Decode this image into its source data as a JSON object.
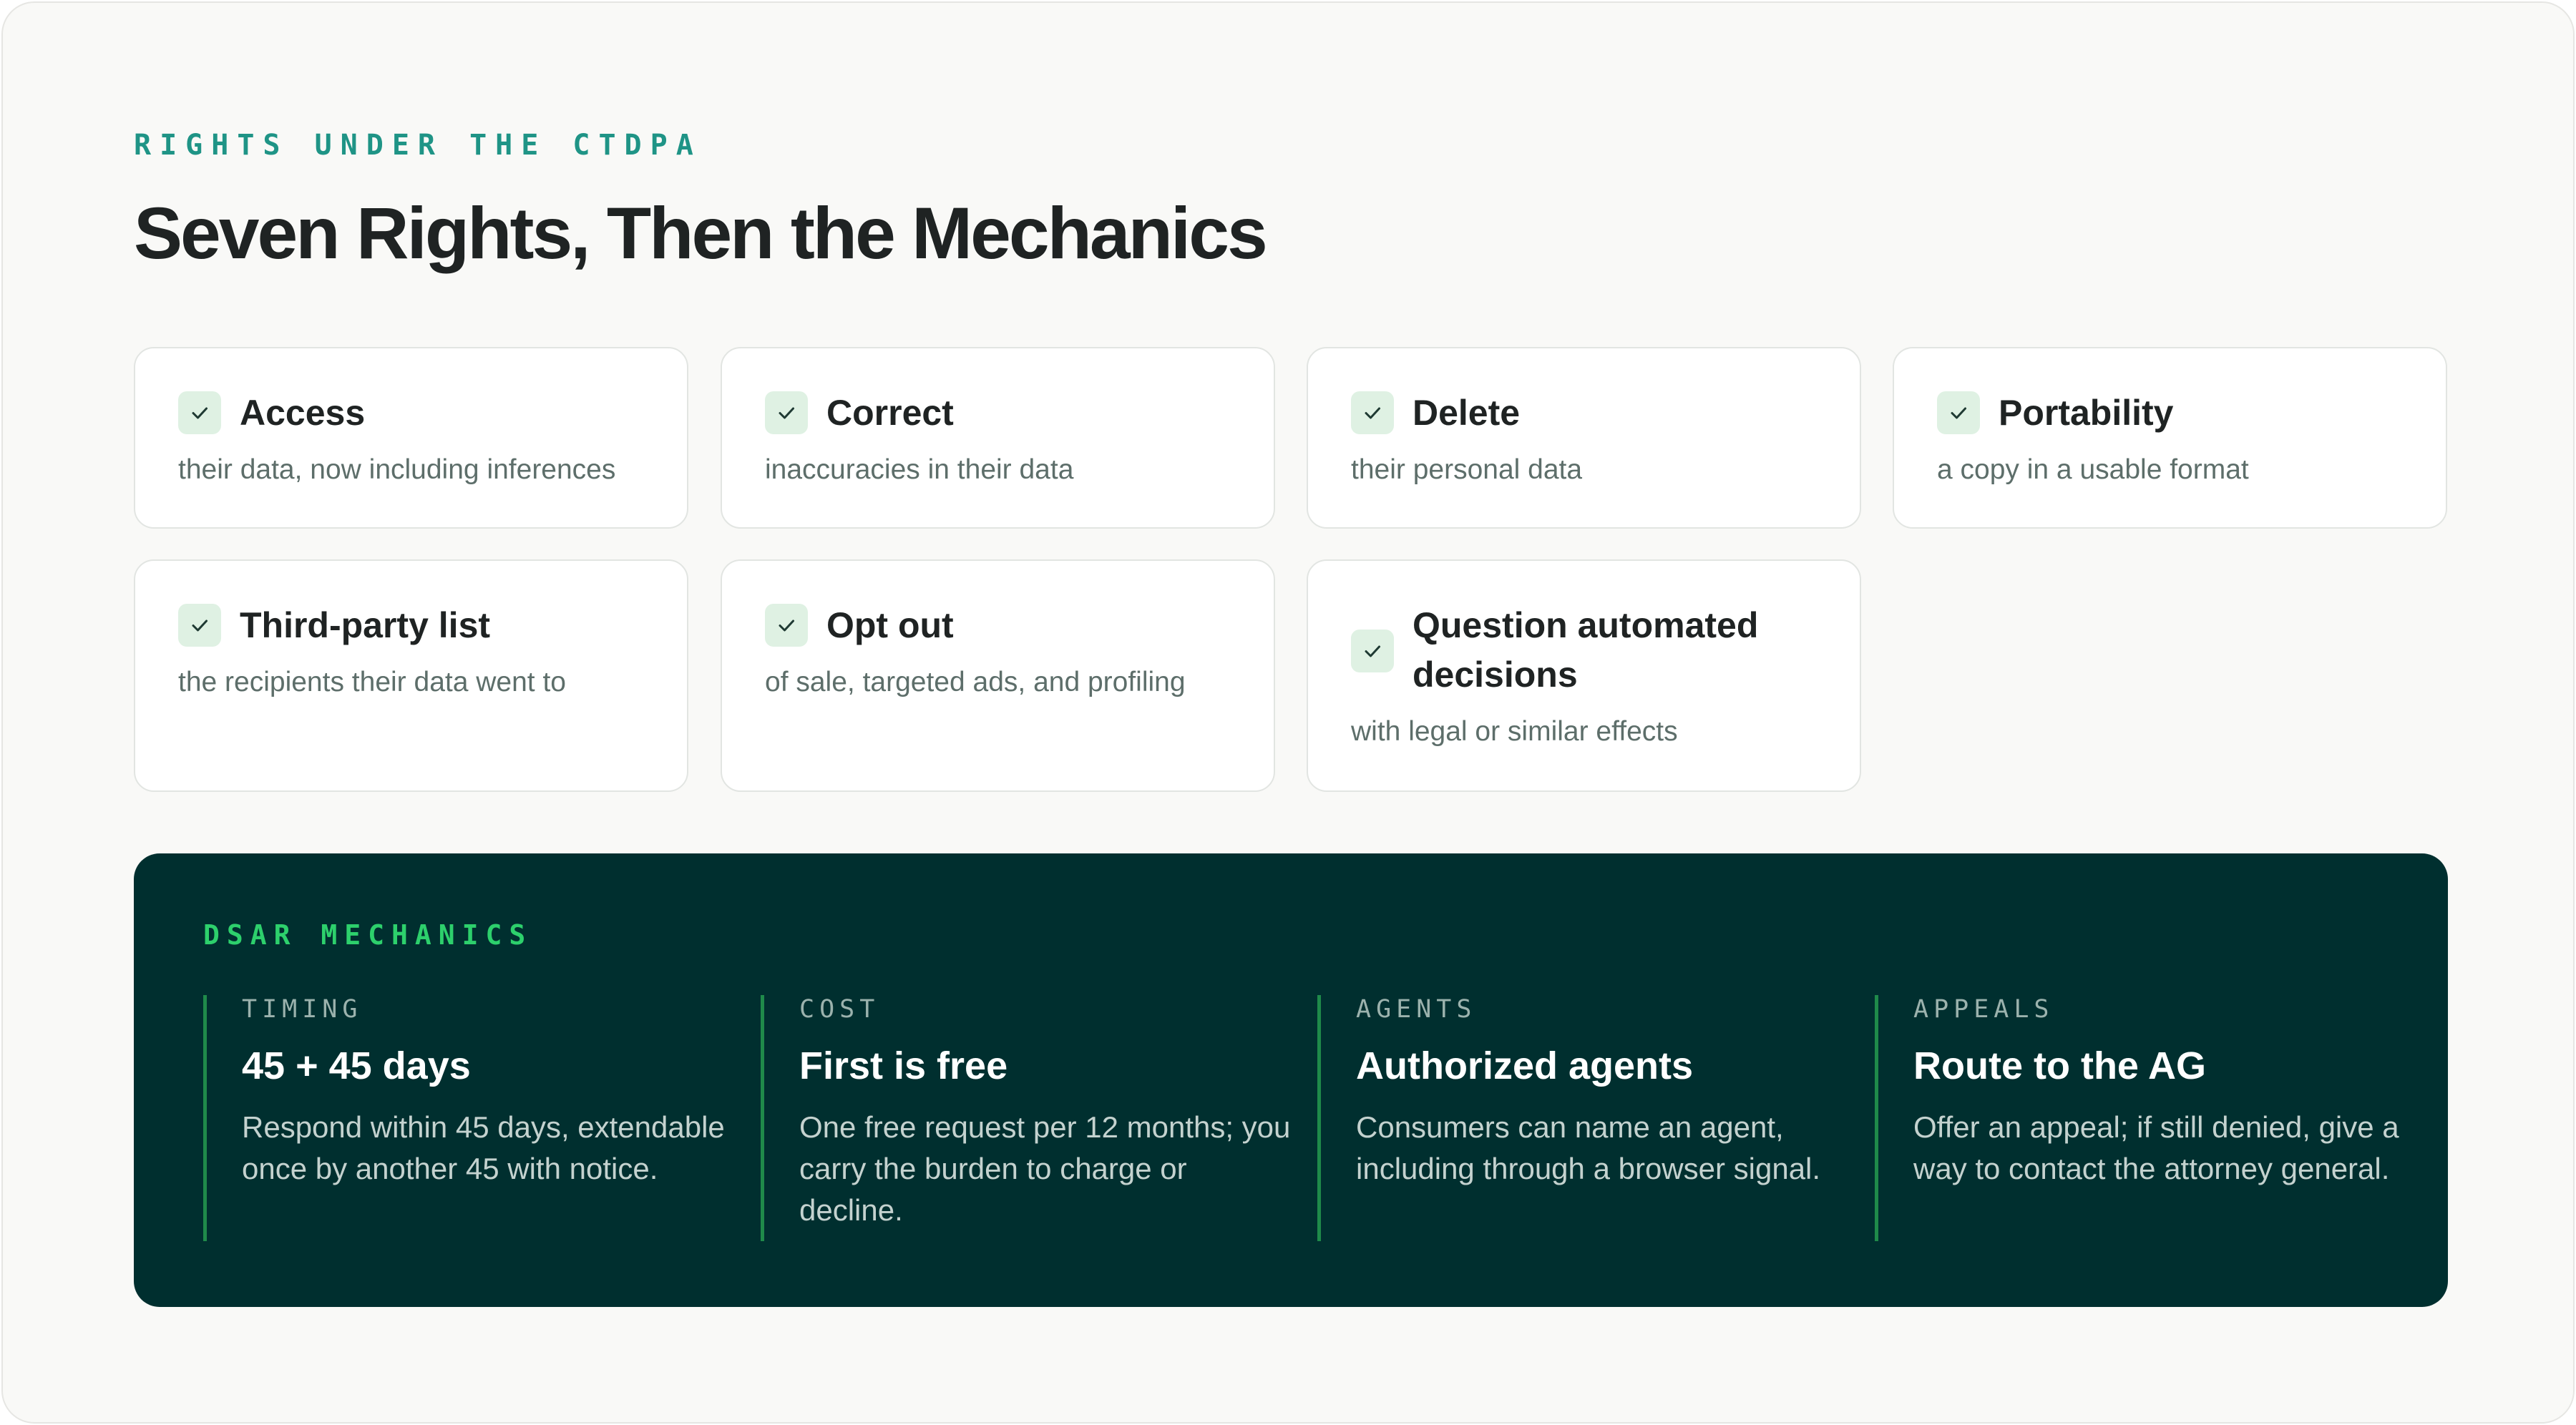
{
  "header": {
    "eyebrow": "RIGHTS UNDER THE CTDPA",
    "title": "Seven Rights, Then the Mechanics"
  },
  "rights": [
    {
      "title": "Access",
      "desc": "their data, now including inferences",
      "icon": "check-icon"
    },
    {
      "title": "Correct",
      "desc": "inaccuracies in their data",
      "icon": "check-icon"
    },
    {
      "title": "Delete",
      "desc": "their personal data",
      "icon": "check-icon"
    },
    {
      "title": "Portability",
      "desc": "a copy in a usable format",
      "icon": "check-icon"
    },
    {
      "title": "Third-party list",
      "desc": "the recipients their data went to",
      "icon": "check-icon"
    },
    {
      "title": "Opt out",
      "desc": "of sale, targeted ads, and profiling",
      "icon": "check-icon"
    },
    {
      "title_line1": "Question automated",
      "title_line2": "decisions",
      "desc": "with legal or similar effects",
      "icon": "check-icon"
    }
  ],
  "mechanics": {
    "label": "DSAR MECHANICS",
    "items": [
      {
        "eyebrow": "TIMING",
        "title": "45 + 45 days",
        "body": "Respond within 45 days, extendable once by another 45 with notice."
      },
      {
        "eyebrow": "COST",
        "title": "First is free",
        "body": "One free request per 12 months; you carry the burden to charge or decline."
      },
      {
        "eyebrow": "AGENTS",
        "title": "Authorized agents",
        "body": "Consumers can name an agent, including through a browser signal."
      },
      {
        "eyebrow": "APPEALS",
        "title": "Route to the AG",
        "body": "Offer an appeal; if still denied, give a way to contact the attorney general."
      }
    ]
  },
  "colors": {
    "accent_teal": "#1f9486",
    "check_bg": "#dff1e3",
    "panel_bg": "#002f2f",
    "panel_accent": "#2dd06c"
  }
}
